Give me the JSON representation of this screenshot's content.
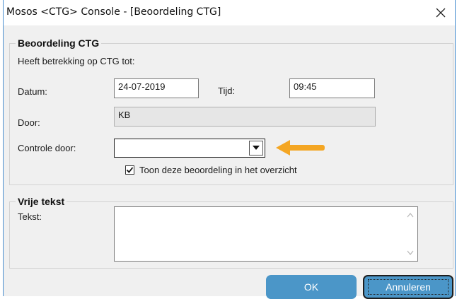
{
  "window": {
    "title": "Mosos <CTG> Console - [Beoordeling CTG]"
  },
  "beoordeling": {
    "legend": "Beoordeling CTG",
    "subtitle": "Heeft betrekking op CTG tot:",
    "datum_label": "Datum:",
    "datum_value": "24-07-2019",
    "tijd_label": "Tijd:",
    "tijd_value": "09:45",
    "door_label": "Door:",
    "door_value": "KB",
    "controle_label": "Controle door:",
    "controle_value": "",
    "checkbox_label": "Toon deze beoordeling in het overzicht",
    "checkbox_checked": true
  },
  "vrije_tekst": {
    "legend": "Vrije tekst",
    "tekst_label": "Tekst:",
    "tekst_value": ""
  },
  "buttons": {
    "ok": "OK",
    "cancel": "Annuleren"
  },
  "colors": {
    "button": "#4b96c8",
    "arrow": "#f4a623",
    "window_border": "#4a8fd0"
  },
  "icons": {
    "close": "close-icon",
    "dropdown": "chevron-down-icon",
    "check": "checkmark-icon",
    "annotation": "arrow-left-icon"
  }
}
